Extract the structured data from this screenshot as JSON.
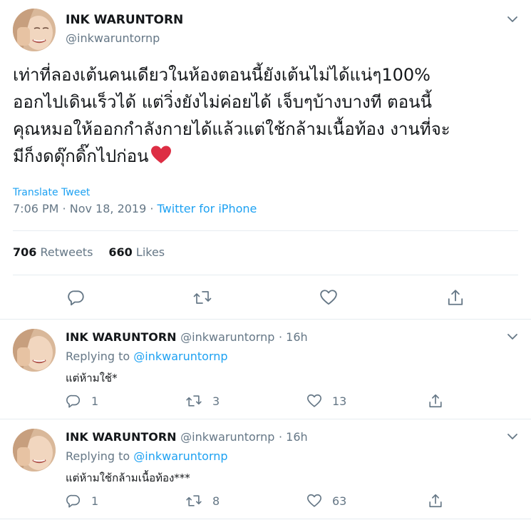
{
  "main_tweet": {
    "name": "INK WARUNTORN",
    "handle": "@inkwaruntornp",
    "text": "เท่าที่ลองเต้นคนเดียวในห้องตอนนี้ยังเต้นไม่ได้แน่ๆ100%\nออกไปเดินเร็วได้ แต่วิ่งยังไม่ค่อยได้ เจ็บๆบ้างบางที ตอนนี้\nคุณหมอให้ออกกำลังกายได้แล้วแต่ใช้กล้ามเนื้อท้อง งานที่จะ\nมีก็งดดุ๊กดิ๊กไปก่อน",
    "emoji": "red-heart",
    "translate_label": "Translate Tweet",
    "time": "7:06 PM · Nov 18, 2019 · ",
    "source": "Twitter for iPhone",
    "retweets_count": "706",
    "retweets_label": "Retweets",
    "likes_count": "660",
    "likes_label": "Likes"
  },
  "replies": [
    {
      "name": "INK WARUNTORN",
      "handle": "@inkwaruntornp",
      "time": "· 16h",
      "replying_label": "Replying to",
      "replying_to": "@inkwaruntornp",
      "text": "แต่ห้ามใช้*",
      "reply_count": "1",
      "retweet_count": "3",
      "like_count": "13"
    },
    {
      "name": "INK WARUNTORN",
      "handle": "@inkwaruntornp",
      "time": "· 16h",
      "replying_label": "Replying to",
      "replying_to": "@inkwaruntornp",
      "text": "แต่ห้ามใช้กล้ามเนื้อท้อง***",
      "reply_count": "1",
      "retweet_count": "8",
      "like_count": "63"
    }
  ],
  "colors": {
    "link": "#1da1f2",
    "muted": "#657786",
    "text": "#14171a",
    "divider": "#e6ecf0",
    "heart_emoji": "#dd2e44"
  },
  "icons": [
    "chevron-down-icon",
    "reply-icon",
    "retweet-icon",
    "like-icon",
    "share-icon"
  ]
}
